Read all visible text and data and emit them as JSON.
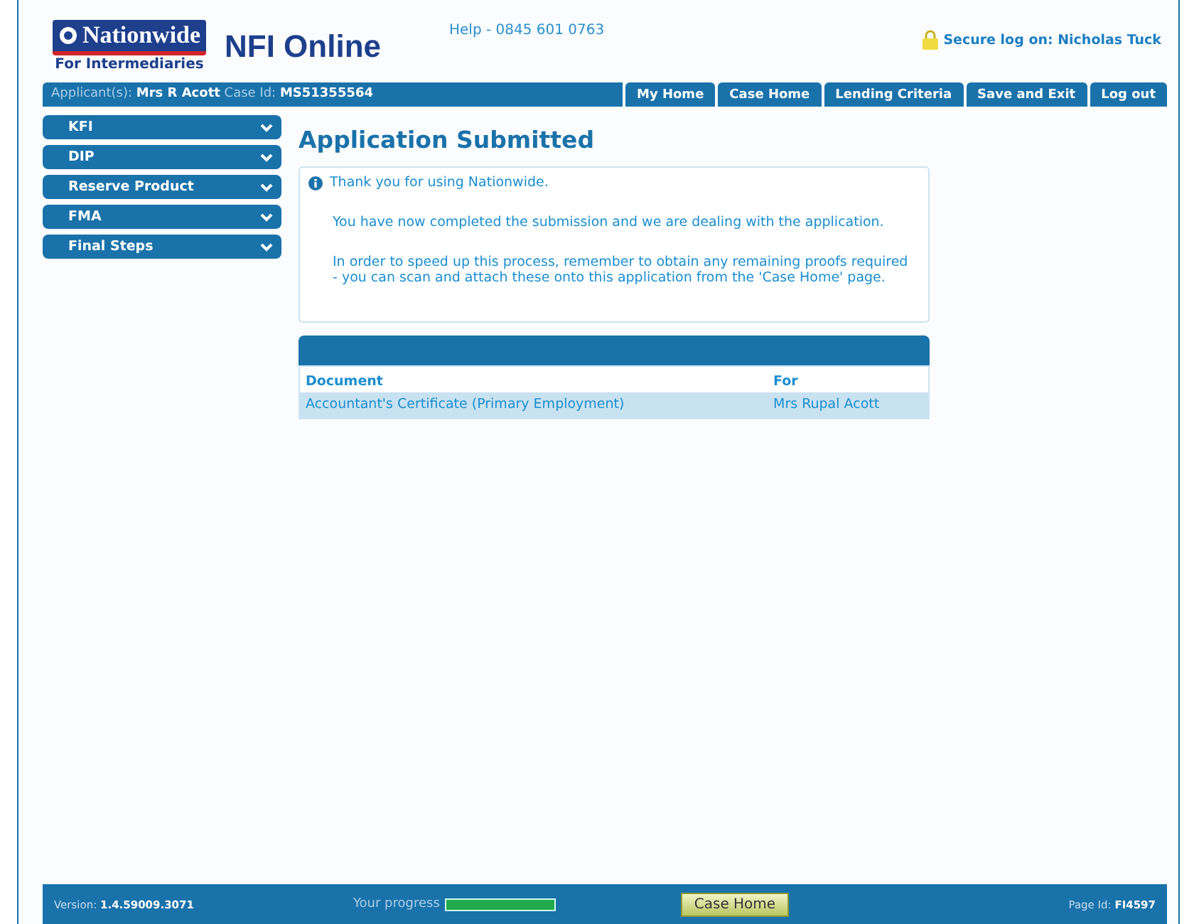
{
  "header": {
    "logo": "Nationwide",
    "logo_subtitle": "For Intermediaries",
    "product": "NFI Online",
    "help": "Help - 0845 601 0763",
    "secure_logon": "Secure log on: Nicholas Tuck"
  },
  "nav": {
    "applicant": "Applicant(s): **Mrs R Acott** Case Id: **MS51355564**",
    "buttons": [
      "My Home",
      "Case Home",
      "Lending Criteria",
      "Save and Exit",
      "Log out"
    ]
  },
  "sidebar": {
    "items": [
      "KFI",
      "DIP",
      "Reserve Product",
      "FMA",
      "Final Steps"
    ]
  },
  "content": {
    "title": "Application Submitted",
    "info": [
      "Thank you for using Nationwide.",
      "You have now completed the submission and we are dealing with the application.",
      "In order to speed up this process, remember to obtain any remaining proofs required - you can scan and attach these onto this application from the 'Case Home' page."
    ],
    "table": {
      "columns": [
        "Document",
        "For"
      ],
      "rows": [
        [
          "Accountant's Certificate (Primary Employment)",
          "Mrs Rupal Acott"
        ]
      ]
    }
  },
  "footer": {
    "version": "Version: **1.4.59009.3071**",
    "progress_label": "Your progress",
    "progress": {
      "level": 1
    },
    "button": "Case Home",
    "page_id": "Page Id: **FI4597**"
  }
}
